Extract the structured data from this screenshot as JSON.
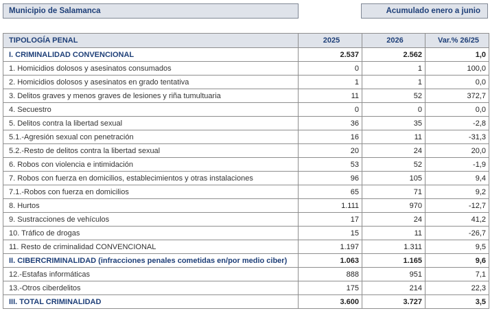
{
  "header": {
    "municipality": "Municipio de Salamanca",
    "period": "Acumulado enero a junio"
  },
  "table": {
    "columns": [
      "TIPOLOGÍA PENAL",
      "2025",
      "2026",
      "Var.% 26/25"
    ],
    "rows": [
      {
        "label": "I. CRIMINALIDAD CONVENCIONAL",
        "y2025": "2.537",
        "y2026": "2.562",
        "var": "1,0",
        "bold": true
      },
      {
        "label": "1. Homicidios dolosos y asesinatos consumados",
        "y2025": "0",
        "y2026": "1",
        "var": "100,0",
        "bold": false
      },
      {
        "label": "2. Homicidios dolosos y asesinatos en grado tentativa",
        "y2025": "1",
        "y2026": "1",
        "var": "0,0",
        "bold": false
      },
      {
        "label": "3. Delitos graves y menos graves de lesiones y riña tumultuaria",
        "y2025": "11",
        "y2026": "52",
        "var": "372,7",
        "bold": false
      },
      {
        "label": "4. Secuestro",
        "y2025": "0",
        "y2026": "0",
        "var": "0,0",
        "bold": false
      },
      {
        "label": "5. Delitos contra la libertad sexual",
        "y2025": "36",
        "y2026": "35",
        "var": "-2,8",
        "bold": false
      },
      {
        "label": "5.1.-Agresión sexual con penetración",
        "y2025": "16",
        "y2026": "11",
        "var": "-31,3",
        "bold": false
      },
      {
        "label": "5.2.-Resto de delitos contra la libertad sexual",
        "y2025": "20",
        "y2026": "24",
        "var": "20,0",
        "bold": false
      },
      {
        "label": "6. Robos con violencia e intimidación",
        "y2025": "53",
        "y2026": "52",
        "var": "-1,9",
        "bold": false
      },
      {
        "label": "7. Robos con fuerza en domicilios, establecimientos y otras instalaciones",
        "y2025": "96",
        "y2026": "105",
        "var": "9,4",
        "bold": false
      },
      {
        "label": "7.1.-Robos con fuerza en domicilios",
        "y2025": "65",
        "y2026": "71",
        "var": "9,2",
        "bold": false
      },
      {
        "label": "8. Hurtos",
        "y2025": "1.111",
        "y2026": "970",
        "var": "-12,7",
        "bold": false
      },
      {
        "label": "9. Sustracciones de vehículos",
        "y2025": "17",
        "y2026": "24",
        "var": "41,2",
        "bold": false
      },
      {
        "label": "10. Tráfico de drogas",
        "y2025": "15",
        "y2026": "11",
        "var": "-26,7",
        "bold": false
      },
      {
        "label": "11. Resto de criminalidad CONVENCIONAL",
        "y2025": "1.197",
        "y2026": "1.311",
        "var": "9,5",
        "bold": false
      },
      {
        "label": "II. CIBERCRIMINALIDAD (infracciones penales cometidas en/por medio ciber)",
        "y2025": "1.063",
        "y2026": "1.165",
        "var": "9,6",
        "bold": true
      },
      {
        "label": "12.-Estafas informáticas",
        "y2025": "888",
        "y2026": "951",
        "var": "7,1",
        "bold": false
      },
      {
        "label": "13.-Otros ciberdelitos",
        "y2025": "175",
        "y2026": "214",
        "var": "22,3",
        "bold": false
      },
      {
        "label": "III. TOTAL CRIMINALIDAD",
        "y2025": "3.600",
        "y2026": "3.727",
        "var": "3,5",
        "bold": true
      }
    ]
  }
}
